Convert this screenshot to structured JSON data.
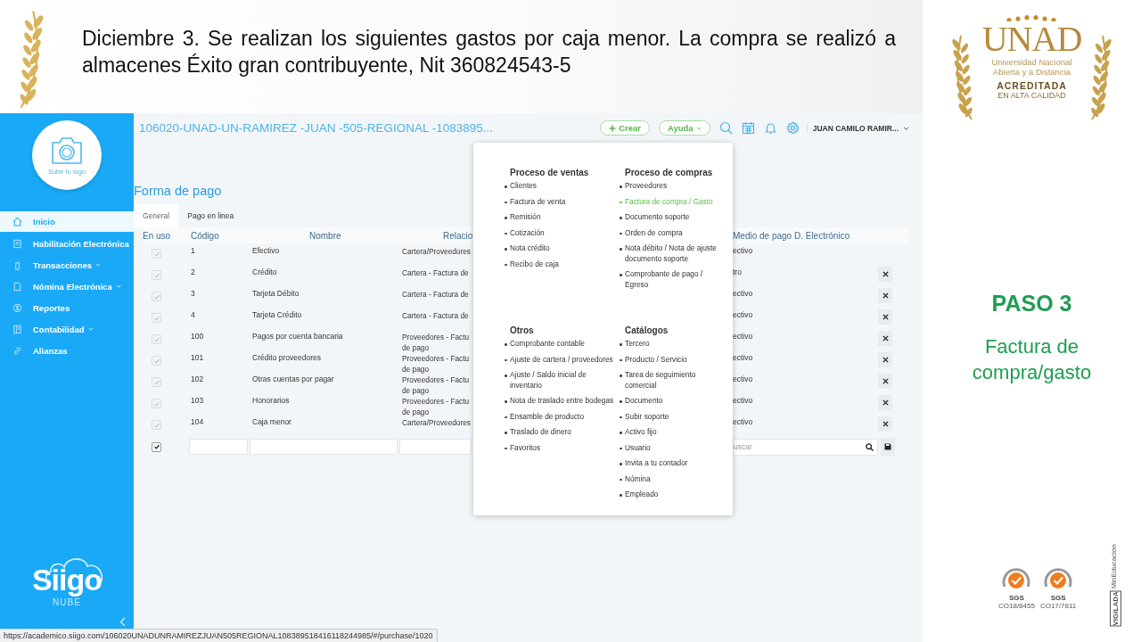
{
  "slide": {
    "heading": "Diciembre 3. Se realizan los siguientes gastos por caja menor. La compra se realizó a almacenes Éxito gran contribuyente, Nit 360824543-5",
    "step": "PASO 3",
    "step_caption": "Factura de compra/gasto"
  },
  "logo": {
    "wordmark": "UNAD",
    "lines": [
      "Universidad Nacional",
      "Abierta y a Distancia"
    ],
    "badge": "ACREDITADA",
    "badge_sub": "EN ALTA CALIDAD"
  },
  "certifications": [
    {
      "mark": "SGS",
      "code": "CO18/8455"
    },
    {
      "mark": "SGS",
      "code": "CO17/7811"
    }
  ],
  "vigilada": {
    "label": "VIGILADA",
    "ministry": "MinEducación"
  },
  "app": {
    "sidebar": {
      "logo_caption": "Sube tu logo",
      "items": [
        {
          "label": "Inicio",
          "selected": true,
          "expandable": false
        },
        {
          "label": "Habilitación Electrónica",
          "selected": false,
          "expandable": false
        },
        {
          "label": "Transacciones",
          "selected": false,
          "expandable": true
        },
        {
          "label": "Nómina Electrónica",
          "selected": false,
          "expandable": true
        },
        {
          "label": "Reportes",
          "selected": false,
          "expandable": false
        },
        {
          "label": "Contabilidad",
          "selected": false,
          "expandable": true
        },
        {
          "label": "Alianzas",
          "selected": false,
          "expandable": false
        }
      ],
      "brand": "Siigo",
      "brand_sub": "NUBE"
    },
    "topbar": {
      "company": "106020-UNAD-UN-RAMIREZ -JUAN -505-REGIONAL -1083895...",
      "create": "Crear",
      "help": "Ayuda",
      "user": "JUAN CAMILO RAMIR..."
    },
    "page": {
      "title": "Forma de pago",
      "tabs": [
        {
          "label": "General",
          "selected": true
        },
        {
          "label": "Pago en linea",
          "selected": false
        }
      ]
    },
    "table": {
      "columns": [
        "En uso",
        "Código",
        "Nombre",
        "Relacio",
        "Medio de pago D. Electrónico"
      ],
      "rows": [
        {
          "checked": true,
          "code": "1",
          "name": "Efectivo",
          "relation": [
            "Cartera/Proveedores"
          ],
          "medium": "ectivo",
          "removable": false
        },
        {
          "checked": true,
          "code": "2",
          "name": "Crédito",
          "relation": [
            "Cartera - Factura de"
          ],
          "medium": "tro",
          "removable": true
        },
        {
          "checked": true,
          "code": "3",
          "name": "Tarjeta Débito",
          "relation": [
            "Cartera - Factura de"
          ],
          "medium": "ectivo",
          "removable": true
        },
        {
          "checked": true,
          "code": "4",
          "name": "Tarjeta Crédito",
          "relation": [
            "Cartera - Factura de"
          ],
          "medium": "ectivo",
          "removable": true
        },
        {
          "checked": true,
          "code": "100",
          "name": "Pagos por cuenta bancaria",
          "relation": [
            "Proveedores - Factu",
            "de pago"
          ],
          "medium": "ectivo",
          "removable": true
        },
        {
          "checked": true,
          "code": "101",
          "name": "Crédito proveedores",
          "relation": [
            "Proveedores - Factu",
            "de pago"
          ],
          "medium": "ectivo",
          "removable": true
        },
        {
          "checked": true,
          "code": "102",
          "name": "Otras cuentas por pagar",
          "relation": [
            "Proveedores - Factu",
            "de pago"
          ],
          "medium": "ectivo",
          "removable": true
        },
        {
          "checked": true,
          "code": "103",
          "name": "Honorarios",
          "relation": [
            "Proveedores - Factu",
            "de pago"
          ],
          "medium": "ectivo",
          "removable": true
        },
        {
          "checked": true,
          "code": "104",
          "name": "Caja menor",
          "relation": [
            "Cartera/Proveedores"
          ],
          "medium": "ectivo",
          "removable": true
        }
      ],
      "new_row": {
        "checked": true,
        "search_placeholder": "uscar"
      }
    },
    "menu": {
      "sections": [
        {
          "title": "Proceso de ventas",
          "items": [
            {
              "label": "Clientes",
              "selected": false
            },
            {
              "label": "Factura de venta",
              "selected": false
            },
            {
              "label": "Remisión",
              "selected": false
            },
            {
              "label": "Cotización",
              "selected": false
            },
            {
              "label": "Nota crédito",
              "selected": false
            },
            {
              "label": "Recibo de caja",
              "selected": false
            }
          ]
        },
        {
          "title": "Proceso de compras",
          "items": [
            {
              "label": "Proveedores",
              "selected": false
            },
            {
              "label": "Factura de compra / Gasto",
              "selected": true
            },
            {
              "label": "Documento soporte",
              "selected": false
            },
            {
              "label": "Orden de compra",
              "selected": false
            },
            {
              "label": "Nota débito / Nota de ajuste documento soporte",
              "selected": false
            },
            {
              "label": "Comprobante de pago / Egreso",
              "selected": false
            }
          ]
        },
        {
          "title": "Otros",
          "items": [
            {
              "label": "Comprobante contable",
              "selected": false
            },
            {
              "label": "Ajuste de cartera / proveedores",
              "selected": false
            },
            {
              "label": "Ajuste / Saldo inicial de inventario",
              "selected": false
            },
            {
              "label": "Nota de traslado entre bodegas",
              "selected": false
            },
            {
              "label": "Ensamble de producto",
              "selected": false
            },
            {
              "label": "Traslado de dinero",
              "selected": false
            },
            {
              "label": "Favoritos",
              "selected": false
            }
          ]
        },
        {
          "title": "Catálogos",
          "items": [
            {
              "label": "Tercero",
              "selected": false
            },
            {
              "label": "Producto / Servicio",
              "selected": false
            },
            {
              "label": "Tarea de seguimiento comercial",
              "selected": false
            },
            {
              "label": "Documento",
              "selected": false
            },
            {
              "label": "Subir soporte",
              "selected": false
            },
            {
              "label": "Activo fijo",
              "selected": false
            },
            {
              "label": "Usuario",
              "selected": false
            },
            {
              "label": "Invita a tu contador",
              "selected": false
            },
            {
              "label": "Nómina",
              "selected": false
            },
            {
              "label": "Empleado",
              "selected": false
            }
          ]
        }
      ]
    },
    "status_url": "https://academico.siigo.com/106020UNADUNRAMIREZJUAN505REGIONAL108389518416118244985/#/purchase/1020"
  }
}
